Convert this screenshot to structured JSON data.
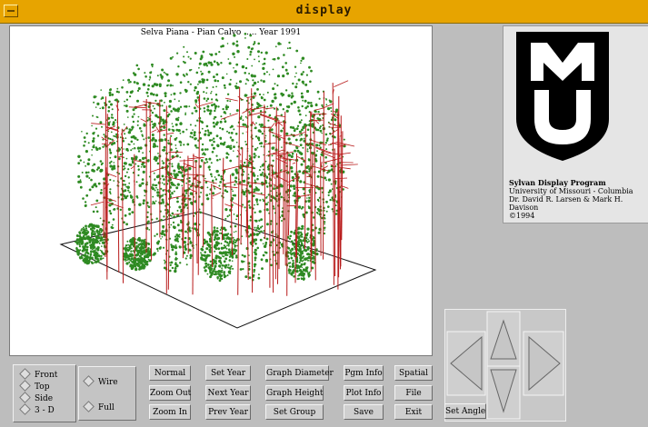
{
  "window": {
    "title": "display"
  },
  "viewport": {
    "caption": "Selva Piana - Pian Calvo ..... Year 1991"
  },
  "info": {
    "program": "Sylvan Display Program",
    "university": "University of Missouri - Columbia",
    "authors": "Dr. David R. Larsen & Mark H. Davison",
    "copyright": "©1994",
    "logo": "MU"
  },
  "view_options": [
    "Front",
    "Top",
    "Side",
    "3 - D"
  ],
  "render_options": [
    "Wire",
    "Full"
  ],
  "buttons": {
    "normal": "Normal",
    "zoom_out": "Zoom Out",
    "zoom_in": "Zoom In",
    "set_year": "Set Year",
    "next_year": "Next Year",
    "prev_year": "Prev Year",
    "graph_diameter": "Graph Diameter",
    "graph_height": "Graph Height",
    "set_group": "Set Group",
    "pgm_info": "Pgm Info",
    "plot_info": "Plot Info",
    "save": "Save",
    "spatial": "Spatial",
    "file": "File",
    "exit": "Exit",
    "set_angle": "Set Angle"
  },
  "colors": {
    "titlebar": "#e7a400",
    "foliage": "#2e8a22",
    "stem": "#b81a1a"
  }
}
